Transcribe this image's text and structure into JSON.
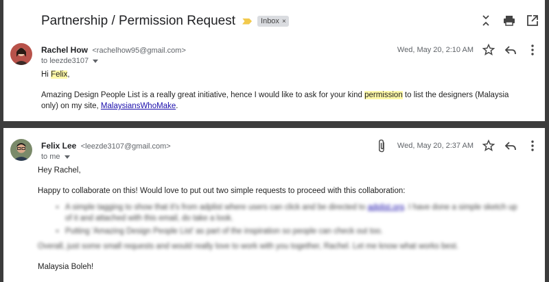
{
  "thread": {
    "subject": "Partnership / Permission Request",
    "label": "Inbox",
    "label_close": "×"
  },
  "message1": {
    "sender_name": "Rachel How",
    "sender_email": "<rachelhow95@gmail.com>",
    "to": "to leezde3107",
    "date": "Wed, May 20, 2:10 AM",
    "greeting_prefix": "Hi ",
    "greeting_name": "Felix",
    "greeting_suffix": ",",
    "body_pre": "Amazing Design People List is a really great initiative, hence I would like to ask for your kind ",
    "body_highlight": "permission",
    "body_post": " to list the designers (Malaysia only) on my site, ",
    "link_text": "MalaysiansWhoMake",
    "body_end": "."
  },
  "message2": {
    "sender_name": "Felix Lee",
    "sender_email": "<leezde3107@gmail.com>",
    "to": "to me",
    "date": "Wed, May 20, 2:37 AM",
    "greeting": "Hey Rachel,",
    "para1": "Happy to collaborate on this! Would love to put out two simple requests to proceed with this collaboration:",
    "bullet1_pre": "A simple tagging to show that it's from adplist where users can click and be directed to ",
    "bullet1_link": "adplist.org",
    "bullet1_post": ". I have done a simple sketch up of it and attached with this email, do take a look.",
    "bullet2": "Putting 'Amazing Design People List' as part of the inspiration so people can check out too.",
    "para2": "Overall, just some small requests and would really love to work with you together, Rachel. Let me know what works best.",
    "signoff": "Malaysia Boleh!"
  },
  "colors": {
    "important_marker": "#f2c94c",
    "highlight": "#fff9a8",
    "link": "#1a0dab",
    "backdrop": "#3c3c3c"
  }
}
